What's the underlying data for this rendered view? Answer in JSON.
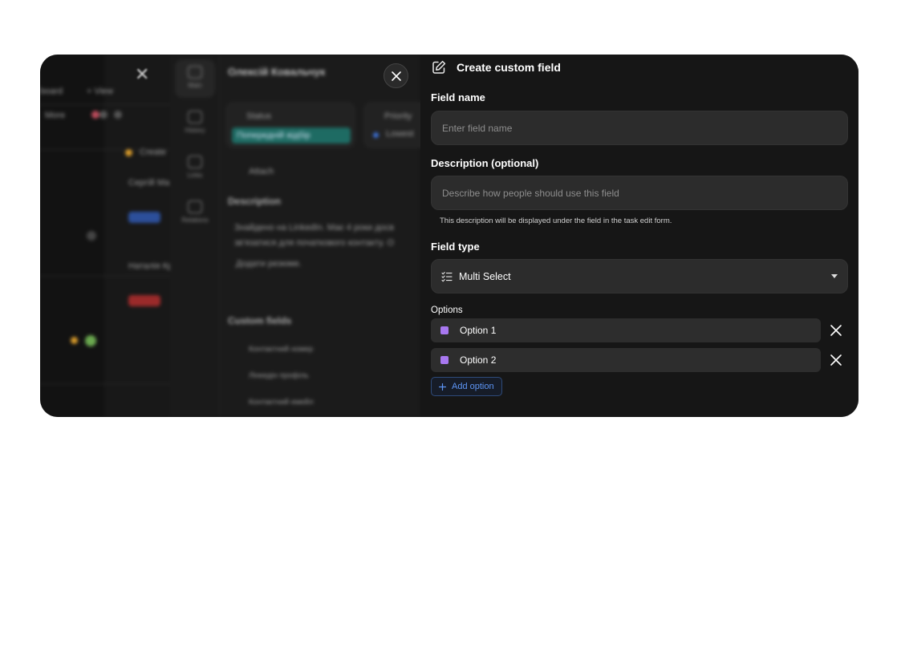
{
  "background": {
    "toolbar_left": "board",
    "toolbar_view": "+ View",
    "filter_chip": "More",
    "column_label": "Create",
    "card_texts": [
      "Сергій Ма",
      "Наталія Кр"
    ],
    "task_title": "Олексій Ковальчук",
    "status_label": "Status",
    "status_value": "Попередній відбір",
    "priority_label": "Priority",
    "priority_value": "Lowest",
    "attach_label": "Attach",
    "description_heading": "Description",
    "description_line1": "Знайдено на LinkedIn. Має 4 роки досв",
    "description_line2": "зв'язатися для початкового контакту. О",
    "description_line3": "Додати резюме.",
    "custom_fields_heading": "Custom fields",
    "custom_fields": [
      "Контактний номер",
      "Лінкедін профіль",
      "Контактний емейл"
    ],
    "rail": [
      {
        "label": "Main",
        "icon": "monitor-icon"
      },
      {
        "label": "History",
        "icon": "history-icon"
      },
      {
        "label": "Links",
        "icon": "link-icon"
      },
      {
        "label": "Relations",
        "icon": "relations-icon"
      }
    ]
  },
  "modal": {
    "title": "Create custom field",
    "field_name": {
      "label": "Field name",
      "placeholder": "Enter field name",
      "value": ""
    },
    "description": {
      "label": "Description (optional)",
      "placeholder": "Describe how people should use this field",
      "value": "",
      "hint": "This description will be displayed under the field in the task edit form."
    },
    "field_type": {
      "label": "Field type",
      "value": "Multi Select"
    },
    "options_label": "Options",
    "options": [
      {
        "label": "Option 1",
        "color": "#a878f0"
      },
      {
        "label": "Option 2",
        "color": "#a878f0"
      }
    ],
    "add_option_label": "Add option"
  },
  "colors": {
    "accent": "#5d95f5",
    "option_swatch": "#a878f0",
    "panel_bg": "#161616",
    "input_bg": "#2c2c2c"
  }
}
